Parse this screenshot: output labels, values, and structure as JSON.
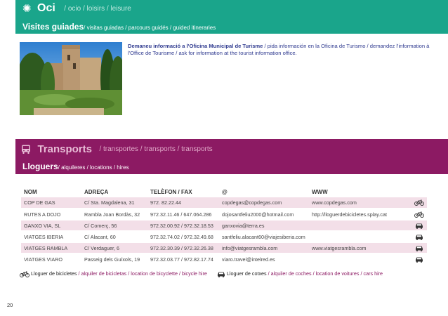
{
  "oci": {
    "title": "Oci",
    "subtitle": "/ ocio / loisirs / leisure",
    "section": "Visites guiades",
    "section_sub": "/ visitas guiadas / parcours guidés / guided itineraries",
    "info_strong": "Demaneu informació a l'Oficina Municipal de Turisme",
    "info_rest": " / pida información en la Oficina de Turismo / demandez l'information à l'Office de Tourisme / ask for information at the tourist information office."
  },
  "transports": {
    "title": "Transports",
    "subtitle": "/ transportes / transports / transports",
    "section": "Lloguers",
    "section_sub": "/ alquileres / locations / hires"
  },
  "table": {
    "headers": {
      "nom": "NOM",
      "adreca": "ADREÇA",
      "telefon": "TELÈFON / FAX",
      "email": "@",
      "www": "WWW"
    },
    "rows": [
      {
        "nom": "COP DE GAS",
        "adreca": "C/ Sta. Magdalena, 31",
        "telefon": "972. 82.22.44",
        "email": "copdegas@copdegas.com",
        "www": "www.copdegas.com",
        "icon": "bicycle-icon"
      },
      {
        "nom": "RUTES A DOJO",
        "adreca": "Rambla Joan Bordàs, 32",
        "telefon": "972.32.11.46 / 647.064.286",
        "email": "dojosantfeliu2000@hotmail.com",
        "www": "http://lloguerdebicicletes.splay.cat",
        "icon": "bicycle-icon"
      },
      {
        "nom": "GANXO  VIA, SL",
        "adreca": "C/ Comerç, 56",
        "telefon": "972.32.00.92 / 972.32.18.53",
        "email": "ganxovia@terra.es",
        "www": "",
        "icon": "car-icon"
      },
      {
        "nom": "VIATGES IBERIA",
        "adreca": "C/ Alacant, 60",
        "telefon": "972.32.74.02 / 972.32.49.68",
        "email": "santfeliu.alacant60@viajesiberia.com",
        "www": "",
        "icon": "car-icon"
      },
      {
        "nom": "VIATGES RAMBLA",
        "adreca": "C/ Verdaguer, 6",
        "telefon": "972.32.30.39 / 972.32.26.38",
        "email": "info@viatgesrambla.com",
        "www": "www.viatgesrambla.com",
        "icon": "car-icon"
      },
      {
        "nom": "VIATGES VIARO",
        "adreca": "Passeig dels Guíxols, 19",
        "telefon": "972.32.03.77 / 972.82.17.74",
        "email": "viaro.travel@intelred.es",
        "www": "",
        "icon": "car-icon"
      }
    ]
  },
  "legend": {
    "bike_main": "Lloguer de bicicletes",
    "bike_rest": " / alquiler de bicicletas / location de bicyclette / bicycle hire",
    "car_main": "Lloguer de cotxes",
    "car_rest": " / alquiler de coches / location de voitures / cars hire"
  },
  "page_number": "20",
  "colors": {
    "oci_green": "#1aa58b",
    "transport_magenta": "#8c1a63",
    "row_pink": "#f3dfe8",
    "info_blue": "#2f3a8f"
  }
}
